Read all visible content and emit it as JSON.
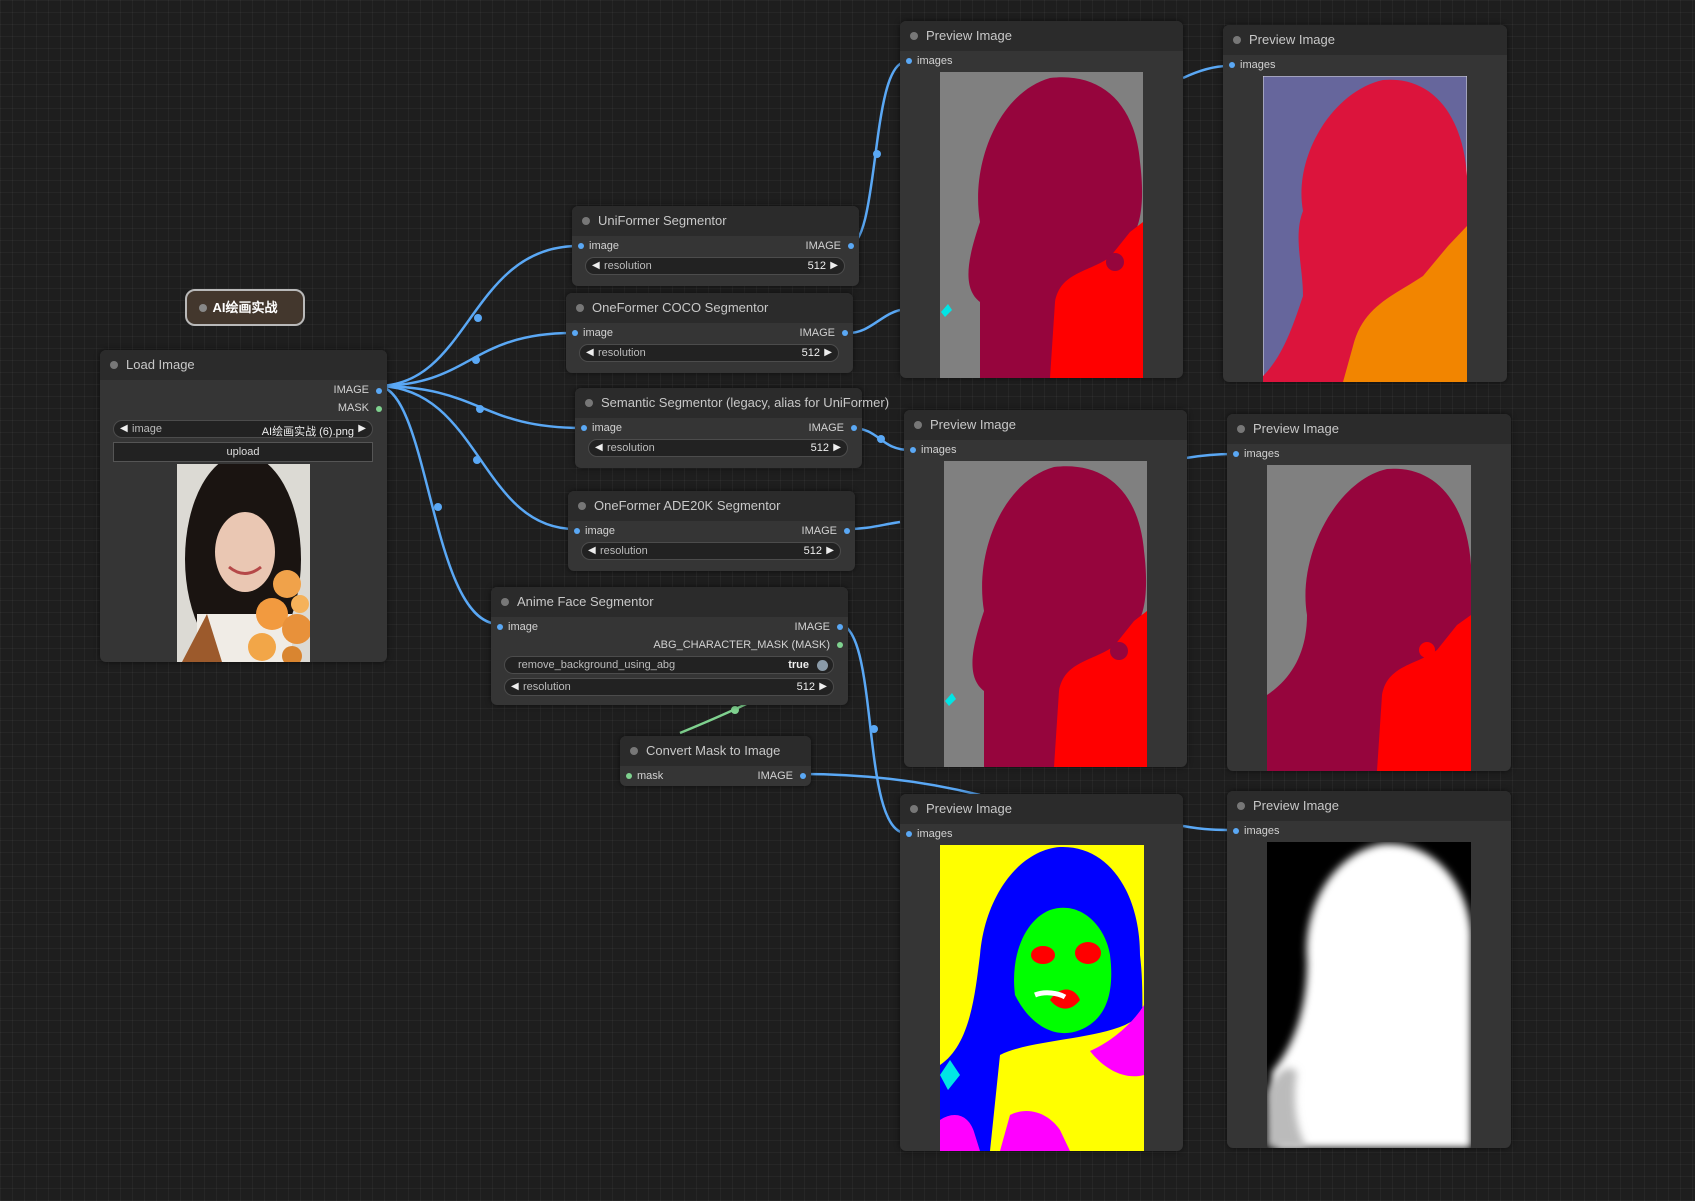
{
  "group": {
    "label": "AI绘画实战"
  },
  "load_image": {
    "title": "Load Image",
    "outputs": [
      "IMAGE",
      "MASK"
    ],
    "image_widget": {
      "label": "image",
      "value": "AI绘画实战 (6).png"
    },
    "upload_label": "upload"
  },
  "uniformer": {
    "title": "UniFormer Segmentor",
    "input": "image",
    "output": "IMAGE",
    "resolution_label": "resolution",
    "resolution_value": "512"
  },
  "oneformer_coco": {
    "title": "OneFormer COCO Segmentor",
    "input": "image",
    "output": "IMAGE",
    "resolution_label": "resolution",
    "resolution_value": "512"
  },
  "semantic": {
    "title": "Semantic Segmentor (legacy, alias for UniFormer)",
    "input": "image",
    "output": "IMAGE",
    "resolution_label": "resolution",
    "resolution_value": "512"
  },
  "oneformer_ade": {
    "title": "OneFormer ADE20K Segmentor",
    "input": "image",
    "output": "IMAGE",
    "resolution_label": "resolution",
    "resolution_value": "512"
  },
  "anime_face": {
    "title": "Anime Face Segmentor",
    "input": "image",
    "outputs": [
      "IMAGE",
      "ABG_CHARACTER_MASK (MASK)"
    ],
    "toggle_label": "remove_background_using_abg",
    "toggle_value": "true",
    "resolution_label": "resolution",
    "resolution_value": "512"
  },
  "convert_mask": {
    "title": "Convert Mask to Image",
    "input": "mask",
    "output": "IMAGE"
  },
  "previews": [
    {
      "title": "Preview Image",
      "input": "images"
    },
    {
      "title": "Preview Image",
      "input": "images"
    },
    {
      "title": "Preview Image",
      "input": "images"
    },
    {
      "title": "Preview Image",
      "input": "images"
    },
    {
      "title": "Preview Image",
      "input": "images"
    },
    {
      "title": "Preview Image",
      "input": "images"
    }
  ],
  "colors": {
    "link_image": "#5aa8f5",
    "link_mask": "#7fd28f",
    "seg_gray": "#808080",
    "seg_person": "#96053d",
    "seg_flower": "#ff0000",
    "seg_person_coco": "#dc143c",
    "seg_bg_coco": "#66669c",
    "seg_flower_coco": "#f28500",
    "anime_bg": "#ffff00",
    "anime_hair": "#0000ff",
    "anime_skin": "#00ff00",
    "anime_cloth": "#ff00ff"
  }
}
